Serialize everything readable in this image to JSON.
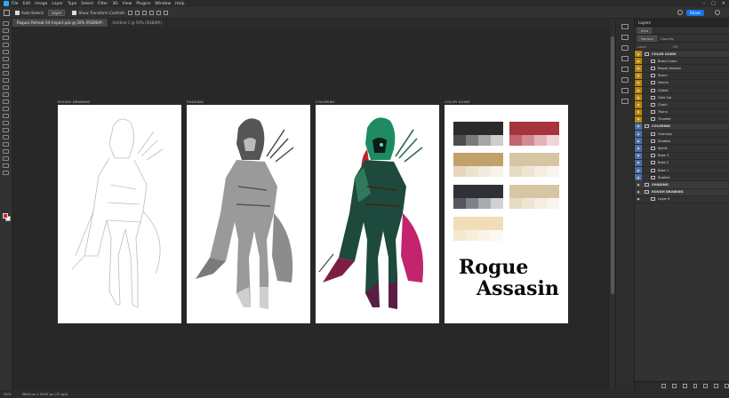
{
  "menu": [
    "File",
    "Edit",
    "Image",
    "Layer",
    "Type",
    "Select",
    "Filter",
    "3D",
    "View",
    "Plugins",
    "Window",
    "Help"
  ],
  "options": {
    "auto_select": "Auto-Select:",
    "auto_select_value": "Layer",
    "show_transform": "Show Transform Controls",
    "share": "Share"
  },
  "tabs": [
    "Rogues Retreat Art Import.psb @ 20% (RGB/8#)",
    "Untitled-1 @ 50% (RGB/8#)"
  ],
  "panel_labels": [
    "ROUGH DRAWING",
    "SHADING",
    "COLORING",
    "COLOR GUIDE"
  ],
  "brand": {
    "line1": "Rogue",
    "line2": "Assasin"
  },
  "colors": {
    "dark": [
      "#2b2b2b",
      "#3a3a3a"
    ],
    "dark_tints": [
      "#4d4d4d",
      "#7a7a7a",
      "#a5a5a5",
      "#cdcdcd"
    ],
    "red": [
      "#a7343d",
      "#b03c44"
    ],
    "red_tints": [
      "#c1656d",
      "#d18c92",
      "#e1b4b8",
      "#eed6d8"
    ],
    "tan": [
      "#c2a06a",
      "#c9a874"
    ],
    "tan_tints": [
      "#e6d7bd",
      "#ede2cf",
      "#f2eadc",
      "#f7f2ea"
    ],
    "sand": [
      "#d7c6a3",
      "#dccbaa"
    ],
    "sand_tints": [
      "#e7dbc3",
      "#eee5d3",
      "#f4eee2",
      "#f9f6f0"
    ],
    "dark2": [
      "#2f3136",
      "#3b3d42"
    ],
    "dark2_tints": [
      "#55575c",
      "#808287",
      "#a9abb0",
      "#d0d1d4"
    ],
    "cream": [
      "#f1ddb8",
      "#f3e2c2"
    ],
    "cream_tints": [
      "#f5e8cf",
      "#f7eedc",
      "#faf4ea",
      "#fcf9f4"
    ]
  },
  "layers": {
    "tab": "Layers",
    "kind": "Kind",
    "mode": "Normal",
    "opacity": "Opacity:",
    "lock": "Lock:",
    "fill": "Fill:",
    "rows": [
      {
        "name": "COLOR GUIDE",
        "group": true
      },
      {
        "name": "Brand Color",
        "group": false
      },
      {
        "name": "Rogue Assasin",
        "group": false
      },
      {
        "name": "Storm",
        "group": false
      },
      {
        "name": "Henna",
        "group": false
      },
      {
        "name": "Gilded",
        "group": false
      },
      {
        "name": "Gala Cer",
        "group": false
      },
      {
        "name": "Chorli",
        "group": false
      },
      {
        "name": "Triana",
        "group": false
      },
      {
        "name": "Thunder",
        "group": false
      },
      {
        "name": "COLORING",
        "group": true
      },
      {
        "name": "Overlays",
        "group": false
      },
      {
        "name": "Shadow",
        "group": false
      },
      {
        "name": "Spells",
        "group": false
      },
      {
        "name": "Base 3",
        "group": false
      },
      {
        "name": "Base 2",
        "group": false
      },
      {
        "name": "Base 1",
        "group": false
      },
      {
        "name": "Strokes",
        "group": false
      },
      {
        "name": "SHADING",
        "group": true
      },
      {
        "name": "ROUGH DRAWING",
        "group": true
      },
      {
        "name": "Layer 0",
        "group": false
      }
    ]
  },
  "status": {
    "zoom": "20%",
    "dims": "3840 px x 2040 px (72 ppi)"
  }
}
